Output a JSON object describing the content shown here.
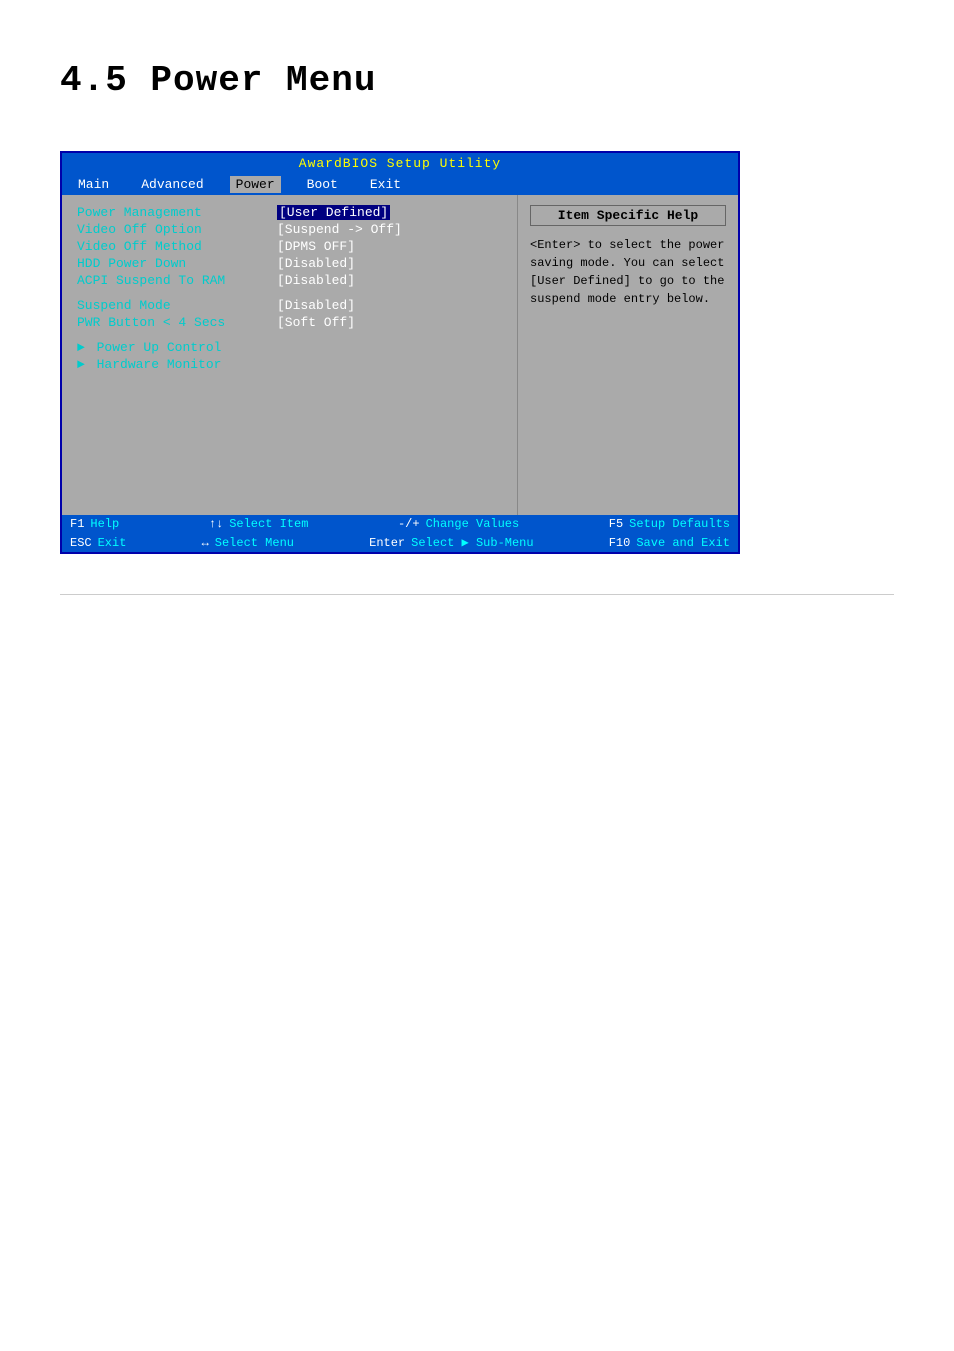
{
  "page": {
    "title": "4.5    Power Menu"
  },
  "bios": {
    "title_bar": "AwardBIOS Setup Utility",
    "menu_items": [
      "Main",
      "Advanced",
      "Power",
      "Boot",
      "Exit"
    ],
    "active_menu": "Power",
    "help": {
      "title": "Item Specific Help",
      "text": "<Enter> to select the power saving mode. You can select [User Defined] to go to the suspend mode entry below."
    },
    "settings": [
      {
        "label": "Power Management",
        "value": "[User Defined]",
        "highlighted": true
      },
      {
        "label": "Video Off Option",
        "value": "[Suspend -> Off]",
        "highlighted": false
      },
      {
        "label": "Video Off Method",
        "value": "[DPMS OFF]",
        "highlighted": false
      },
      {
        "label": "HDD Power Down",
        "value": "[Disabled]",
        "highlighted": false
      },
      {
        "label": "ACPI Suspend To RAM",
        "value": "[Disabled]",
        "highlighted": false
      }
    ],
    "settings2": [
      {
        "label": "Suspend Mode",
        "value": "[Disabled]",
        "highlighted": false
      },
      {
        "label": "PWR Button < 4 Secs",
        "value": "[Soft Off]",
        "highlighted": false
      }
    ],
    "submenus": [
      "Power Up Control",
      "Hardware Monitor"
    ],
    "footer_rows": [
      [
        {
          "key": "F1",
          "desc": "Help"
        },
        {
          "key": "↑↓",
          "desc": "Select Item"
        },
        {
          "key": "-/+",
          "desc": "Change Values"
        },
        {
          "key": "F5",
          "desc": "Setup Defaults"
        }
      ],
      [
        {
          "key": "ESC",
          "desc": "Exit"
        },
        {
          "key": "↔",
          "desc": "Select Menu"
        },
        {
          "key": "Enter",
          "desc": "Select ▶ Sub-Menu"
        },
        {
          "key": "F10",
          "desc": "Save and Exit"
        }
      ]
    ]
  }
}
